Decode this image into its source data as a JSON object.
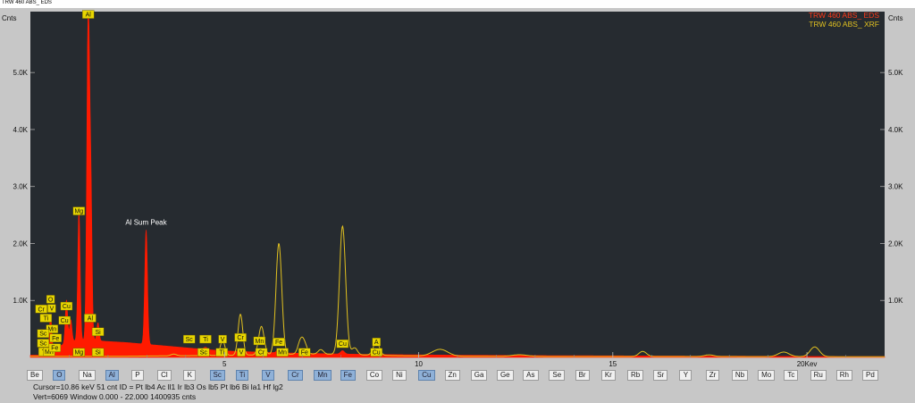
{
  "window_title": "TRW 460 ABS_ EDS",
  "element_buttons": [
    {
      "label": "Be",
      "active": false
    },
    {
      "label": "O",
      "active": true
    },
    {
      "label": "Na",
      "active": false
    },
    {
      "label": "Al",
      "active": true
    },
    {
      "label": "P",
      "active": false
    },
    {
      "label": "Cl",
      "active": false
    },
    {
      "label": "K",
      "active": false
    },
    {
      "label": "Sc",
      "active": true
    },
    {
      "label": "Ti",
      "active": true
    },
    {
      "label": "V",
      "active": true
    },
    {
      "label": "Cr",
      "active": true
    },
    {
      "label": "Mn",
      "active": true
    },
    {
      "label": "Fe",
      "active": true
    },
    {
      "label": "Co",
      "active": false
    },
    {
      "label": "Ni",
      "active": false
    },
    {
      "label": "Cu",
      "active": true
    },
    {
      "label": "Zn",
      "active": false
    },
    {
      "label": "Ga",
      "active": false
    },
    {
      "label": "Ge",
      "active": false
    },
    {
      "label": "As",
      "active": false
    },
    {
      "label": "Se",
      "active": false
    },
    {
      "label": "Br",
      "active": false
    },
    {
      "label": "Kr",
      "active": false
    },
    {
      "label": "Rb",
      "active": false
    },
    {
      "label": "Sr",
      "active": false
    },
    {
      "label": "Y",
      "active": false
    },
    {
      "label": "Zr",
      "active": false
    },
    {
      "label": "Nb",
      "active": false
    },
    {
      "label": "Mo",
      "active": false
    },
    {
      "label": "Tc",
      "active": false
    },
    {
      "label": "Ru",
      "active": false
    },
    {
      "label": "Rh",
      "active": false
    },
    {
      "label": "Pd",
      "active": false
    }
  ],
  "status": {
    "line1": "Cursor=10.86 keV   51 cnt  ID = Pt lb4  Ac ll1  Ir lb3  Os lb5  Pt lb6  Bi la1  Hf lg2",
    "line2": "Vert=6069          Window 0.000 - 22.000    1400935 cnts"
  },
  "chart_data": {
    "type": "line",
    "ylabel": "Cnts",
    "xunit": "Kev",
    "xlim": [
      0,
      22.0
    ],
    "ylim": [
      0,
      6069
    ],
    "x_ticks": [
      {
        "v": 5,
        "label": "5"
      },
      {
        "v": 10,
        "label": "10"
      },
      {
        "v": 15,
        "label": "15"
      },
      {
        "v": 20,
        "label": "20Kev"
      }
    ],
    "y_ticks": [
      {
        "v": 1000,
        "label": "1.0K"
      },
      {
        "v": 2000,
        "label": "2.0K"
      },
      {
        "v": 3000,
        "label": "3.0K"
      },
      {
        "v": 4000,
        "label": "4.0K"
      },
      {
        "v": 5000,
        "label": "5.0K"
      }
    ],
    "legend_position": "top-right",
    "colors": {
      "background": "#262b30",
      "eds": "#ff1a00",
      "xrf": "#e0c020",
      "label_box": "#e8d600",
      "text": "#ffffff"
    },
    "series": [
      {
        "name": "TRW 460 ABS_ EDS",
        "style": "filled",
        "baseline": [
          [
            0.3,
            40
          ],
          [
            0.7,
            180
          ],
          [
            1.0,
            280
          ],
          [
            1.3,
            310
          ],
          [
            1.6,
            300
          ],
          [
            2.0,
            280
          ],
          [
            2.5,
            260
          ],
          [
            3.0,
            230
          ],
          [
            3.5,
            200
          ],
          [
            4.0,
            170
          ],
          [
            4.5,
            140
          ],
          [
            5.0,
            115
          ],
          [
            6.0,
            90
          ],
          [
            7.0,
            72
          ],
          [
            8.0,
            60
          ],
          [
            9.0,
            52
          ],
          [
            10.0,
            45
          ],
          [
            11.0,
            40
          ],
          [
            12.0,
            36
          ],
          [
            13.0,
            33
          ],
          [
            14.0,
            30
          ],
          [
            15.0,
            28
          ],
          [
            16.0,
            26
          ],
          [
            17.0,
            24
          ],
          [
            18.0,
            22
          ],
          [
            19.0,
            20
          ],
          [
            20.0,
            18
          ],
          [
            21.0,
            16
          ],
          [
            22.0,
            14
          ]
        ],
        "peaks": [
          {
            "x": 0.28,
            "h": 120,
            "w": 0.025
          },
          {
            "x": 0.52,
            "h": 620,
            "w": 0.03
          },
          {
            "x": 0.93,
            "h": 760,
            "w": 0.03
          },
          {
            "x": 1.04,
            "h": 380,
            "w": 0.03
          },
          {
            "x": 1.25,
            "h": 2300,
            "w": 0.03
          },
          {
            "x": 1.49,
            "h": 5900,
            "w": 0.035
          },
          {
            "x": 1.56,
            "h": 2400,
            "w": 0.03
          },
          {
            "x": 1.74,
            "h": 320,
            "w": 0.03
          },
          {
            "x": 2.98,
            "h": 2020,
            "w": 0.035
          },
          {
            "x": 4.51,
            "h": 40,
            "w": 0.05
          },
          {
            "x": 5.9,
            "h": 50,
            "w": 0.05
          },
          {
            "x": 6.4,
            "h": 70,
            "w": 0.05
          },
          {
            "x": 8.04,
            "h": 60,
            "w": 0.05
          }
        ]
      },
      {
        "name": "TRW 460 ABS_ XRF",
        "style": "line",
        "baseline": [
          [
            0,
            20
          ],
          [
            2,
            18
          ],
          [
            4,
            30
          ],
          [
            5,
            35
          ],
          [
            6,
            45
          ],
          [
            7,
            60
          ],
          [
            8,
            55
          ],
          [
            9,
            35
          ],
          [
            10,
            25
          ],
          [
            11,
            20
          ],
          [
            12,
            18
          ],
          [
            14,
            15
          ],
          [
            16,
            15
          ],
          [
            18,
            15
          ],
          [
            20,
            14
          ],
          [
            22,
            12
          ]
        ],
        "peaks": [
          {
            "x": 3.69,
            "h": 30,
            "w": 0.07
          },
          {
            "x": 4.51,
            "h": 60,
            "w": 0.06
          },
          {
            "x": 4.95,
            "h": 260,
            "w": 0.06
          },
          {
            "x": 5.41,
            "h": 720,
            "w": 0.06
          },
          {
            "x": 5.95,
            "h": 500,
            "w": 0.07
          },
          {
            "x": 6.4,
            "h": 1950,
            "w": 0.075
          },
          {
            "x": 6.96,
            "h": 220,
            "w": 0.07
          },
          {
            "x": 7.06,
            "h": 160,
            "w": 0.07
          },
          {
            "x": 7.48,
            "h": 80,
            "w": 0.07
          },
          {
            "x": 8.04,
            "h": 2250,
            "w": 0.08
          },
          {
            "x": 8.35,
            "h": 120,
            "w": 0.07
          },
          {
            "x": 8.91,
            "h": 230,
            "w": 0.08
          },
          {
            "x": 10.55,
            "h": 120,
            "w": 0.2
          },
          {
            "x": 12.6,
            "h": 30,
            "w": 0.2
          },
          {
            "x": 15.77,
            "h": 90,
            "w": 0.1
          },
          {
            "x": 17.48,
            "h": 30,
            "w": 0.12
          },
          {
            "x": 19.4,
            "h": 80,
            "w": 0.14
          },
          {
            "x": 20.2,
            "h": 170,
            "w": 0.12
          }
        ]
      }
    ],
    "annotations": [
      {
        "x": 2.98,
        "y": 2330,
        "text": "Al Sum Peak"
      }
    ],
    "element_labels": [
      {
        "text": "Al",
        "x": 1.49,
        "y": 5950
      },
      {
        "text": "Mg",
        "x": 1.25,
        "y": 2500
      },
      {
        "text": "O",
        "x": 0.52,
        "y": 950
      },
      {
        "text": "Cr",
        "x": 0.28,
        "y": 780
      },
      {
        "text": "V",
        "x": 0.55,
        "y": 790
      },
      {
        "text": "Cu",
        "x": 0.93,
        "y": 830
      },
      {
        "text": "Ti",
        "x": 0.4,
        "y": 620
      },
      {
        "text": "Cu",
        "x": 0.88,
        "y": 580
      },
      {
        "text": "Mn",
        "x": 0.56,
        "y": 430
      },
      {
        "text": "Al",
        "x": 1.54,
        "y": 620
      },
      {
        "text": "Sc",
        "x": 0.33,
        "y": 350
      },
      {
        "text": "Fe",
        "x": 0.65,
        "y": 270
      },
      {
        "text": "Si",
        "x": 1.74,
        "y": 380
      },
      {
        "text": "Sc",
        "x": 0.33,
        "y": 180
      },
      {
        "text": "Ti",
        "x": 0.36,
        "y": 30
      },
      {
        "text": "Mn",
        "x": 0.48,
        "y": 30
      },
      {
        "text": "Fe",
        "x": 0.63,
        "y": 100
      },
      {
        "text": "Mg",
        "x": 1.25,
        "y": 20
      },
      {
        "text": "Si",
        "x": 1.74,
        "y": 20
      },
      {
        "text": "Sc",
        "x": 4.09,
        "y": 250
      },
      {
        "text": "Sc",
        "x": 4.46,
        "y": 20
      },
      {
        "text": "Ti",
        "x": 4.51,
        "y": 250
      },
      {
        "text": "Ti",
        "x": 4.93,
        "y": 20
      },
      {
        "text": "V",
        "x": 4.95,
        "y": 250
      },
      {
        "text": "V",
        "x": 5.43,
        "y": 20
      },
      {
        "text": "Cr",
        "x": 5.41,
        "y": 280
      },
      {
        "text": "Cr",
        "x": 5.95,
        "y": 20
      },
      {
        "text": "Mn",
        "x": 5.9,
        "y": 220
      },
      {
        "text": "Mn",
        "x": 6.49,
        "y": 20
      },
      {
        "text": "Fe",
        "x": 6.4,
        "y": 200
      },
      {
        "text": "Fe",
        "x": 7.06,
        "y": 20
      },
      {
        "text": "Cu",
        "x": 8.04,
        "y": 170
      },
      {
        "text": "Cu",
        "x": 8.91,
        "y": 20
      },
      {
        "text": "A",
        "x": 8.91,
        "y": 200
      }
    ]
  }
}
